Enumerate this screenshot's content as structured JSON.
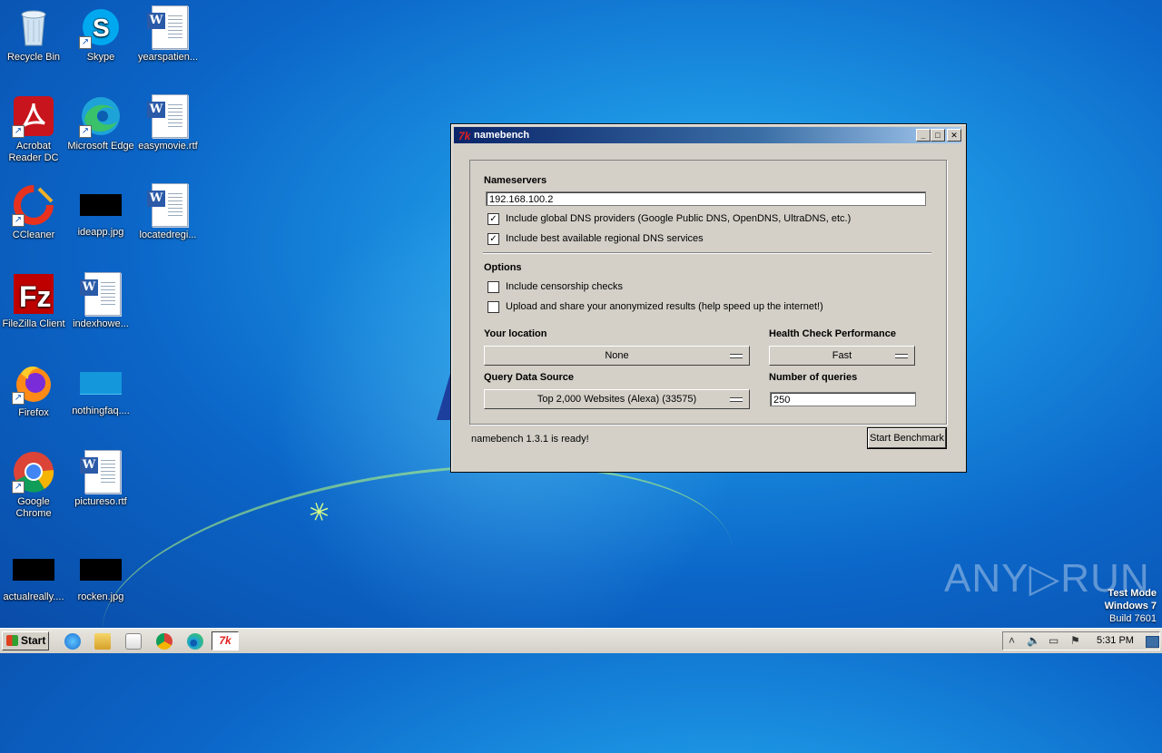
{
  "desktop": {
    "icons": [
      {
        "label": "Recycle Bin"
      },
      {
        "label": "Skype"
      },
      {
        "label": "yearspatien..."
      },
      {
        "label": "Acrobat Reader DC"
      },
      {
        "label": "Microsoft Edge"
      },
      {
        "label": "easymovie.rtf"
      },
      {
        "label": "CCleaner"
      },
      {
        "label": "ideapp.jpg"
      },
      {
        "label": "locatedregi..."
      },
      {
        "label": "FileZilla Client"
      },
      {
        "label": "indexhowe..."
      },
      {
        "label": "Firefox"
      },
      {
        "label": "nothingfaq...."
      },
      {
        "label": "Google Chrome"
      },
      {
        "label": "pictureso.rtf"
      },
      {
        "label": "actualreally...."
      },
      {
        "label": "rocken.jpg"
      }
    ]
  },
  "window": {
    "title": "namebench",
    "controls": {
      "minimize": "_",
      "maximize": "□",
      "close": "✕"
    },
    "nameservers": {
      "label": "Nameservers",
      "value": "192.168.100.2",
      "global_dns": {
        "checked": true,
        "label": "Include global DNS providers (Google Public DNS, OpenDNS, UltraDNS, etc.)"
      },
      "regional_dns": {
        "checked": true,
        "label": "Include best available regional DNS services"
      }
    },
    "options": {
      "label": "Options",
      "censorship": {
        "checked": false,
        "label": "Include censorship checks"
      },
      "upload": {
        "checked": false,
        "label": "Upload and share your anonymized results (help speed up the internet!)"
      }
    },
    "location": {
      "label": "Your location",
      "value": "None"
    },
    "health": {
      "label": "Health Check Performance",
      "value": "Fast"
    },
    "data_source": {
      "label": "Query Data Source",
      "value": "Top 2,000 Websites (Alexa) (33575)"
    },
    "queries": {
      "label": "Number of queries",
      "value": "250"
    },
    "status": "namebench 1.3.1 is ready!",
    "start_button": "Start Benchmark"
  },
  "watermark": {
    "text": "ANY▷RUN"
  },
  "system": {
    "line1": "Test Mode",
    "line2": "Windows 7",
    "line3": "Build 7601"
  },
  "taskbar": {
    "start": "Start",
    "time": "5:31 PM"
  }
}
